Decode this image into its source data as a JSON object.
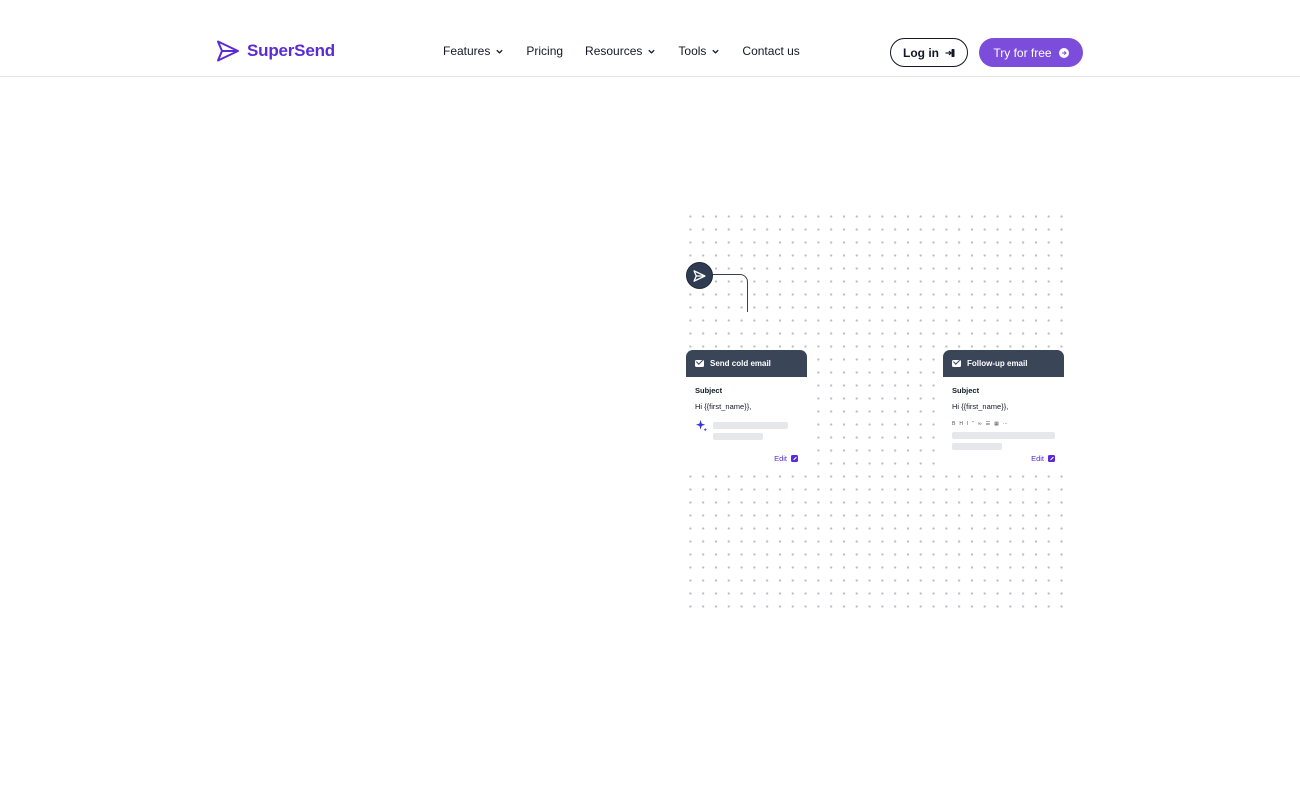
{
  "brand": {
    "name": "SuperSend",
    "color": "#5b2bd6"
  },
  "nav": {
    "items": [
      {
        "label": "Features",
        "has_dropdown": true
      },
      {
        "label": "Pricing",
        "has_dropdown": false
      },
      {
        "label": "Resources",
        "has_dropdown": true
      },
      {
        "label": "Tools",
        "has_dropdown": true
      },
      {
        "label": "Contact us",
        "has_dropdown": false
      }
    ]
  },
  "actions": {
    "login_label": "Log in",
    "try_label": "Try for free",
    "try_color": "#7c4ddb"
  },
  "workflow": {
    "start_icon": "paper-plane-icon",
    "cards": [
      {
        "title": "Send cold email",
        "subject_label": "Subject",
        "greeting": "Hi {{first_name}},",
        "accent_icon": "sparkle-icon",
        "edit_label": "Edit"
      },
      {
        "title": "Follow-up email",
        "subject_label": "Subject",
        "greeting": "Hi {{first_name}},",
        "toolbar": [
          "B",
          "H",
          "I",
          "”",
          "∞",
          "☰",
          "▦",
          "⋯"
        ],
        "edit_label": "Edit"
      }
    ]
  }
}
